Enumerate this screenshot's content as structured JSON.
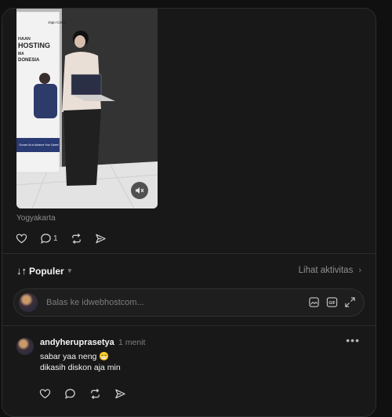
{
  "post": {
    "location": "Yogyakarta",
    "reply_count": "1",
    "media_banner_lines": [
      "HAAN",
      "HOSTING",
      "MA",
      "DONESIA"
    ],
    "media_tagline": "Choose Us to Advance Your Career!"
  },
  "replies": {
    "sort_label": "Populer",
    "activity_link": "Lihat aktivitas",
    "reply_placeholder": "Balas ke idwebhostcom..."
  },
  "comment": {
    "username": "andyheruprasetya",
    "time": "1 menit",
    "line1": "sabar yaa neng 😁",
    "line2": "dikasih diskon aja min"
  },
  "icons": {
    "like": "heart-icon",
    "reply": "comment-icon",
    "repost": "repost-icon",
    "share": "send-icon",
    "mute": "muted-speaker-icon",
    "image": "image-icon",
    "gif": "gif-icon",
    "expand": "expand-icon",
    "more": "more-icon"
  },
  "colors": {
    "background": "#101010",
    "panel": "#181818",
    "text": "#f3f5f7",
    "muted": "#7f7f7f"
  }
}
